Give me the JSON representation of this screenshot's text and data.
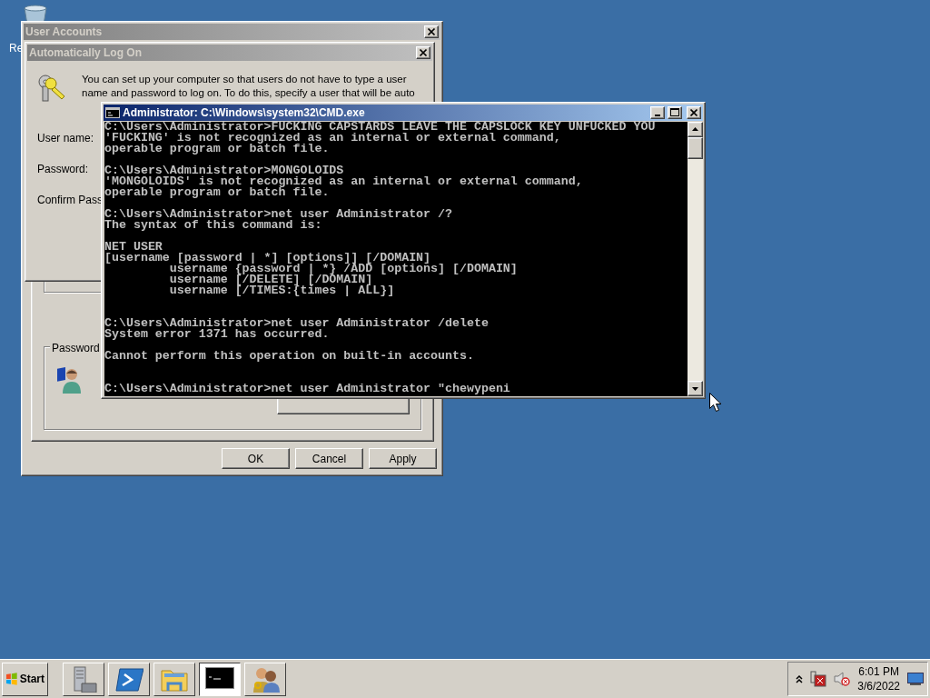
{
  "recycle_bin": {
    "label": "Re"
  },
  "user_accounts": {
    "title": "User Accounts",
    "active": false,
    "group_label": "Password",
    "buttons": [
      {
        "label": "OK"
      },
      {
        "label": "Cancel"
      },
      {
        "label": "Apply"
      }
    ]
  },
  "auto_logon": {
    "title": "Automatically Log On",
    "active": false,
    "description": "You can set up your computer so that users do not have to type a user name and password to log on. To do this, specify a user that will be auto",
    "fields": [
      {
        "label": "User name:"
      },
      {
        "label": "Password:"
      },
      {
        "label": "Confirm Pass"
      }
    ]
  },
  "console": {
    "title": "Administrator: C:\\Windows\\system32\\CMD.exe",
    "active": true,
    "lines": [
      {
        "text": "C:\\Users\\Administrator>FUCKING CAPSTARDS LEAVE THE CAPSLOCK KEY UNFUCKED YOU",
        "kind": "continued"
      },
      {
        "text": "'FUCKING' is not recognized as an internal or external command,",
        "kind": "continued"
      },
      {
        "text": "operable program or batch file.",
        "kind": "continued"
      },
      {
        "text": "C:\\Users\\Administrator>MONGOLOIDS",
        "kind": "spaced"
      },
      {
        "text": "'MONGOLOIDS' is not recognized as an internal or external command,",
        "kind": "continued"
      },
      {
        "text": "operable program or batch file.",
        "kind": "continued"
      },
      {
        "text": "C:\\Users\\Administrator>net user Administrator /?",
        "kind": "spaced"
      },
      {
        "text": "The syntax of this command is:",
        "kind": "continued"
      },
      {
        "text": "NET USER",
        "kind": "spaced"
      },
      {
        "text": "[username [password | *] [options]] [/DOMAIN]",
        "kind": "continued"
      },
      {
        "text": "         username {password | *} /ADD [options] [/DOMAIN]",
        "kind": "continued"
      },
      {
        "text": "         username [/DELETE] [/DOMAIN]",
        "kind": "continued"
      },
      {
        "text": "         username [/TIMES:{times | ALL}]",
        "kind": "continued"
      },
      {
        "text": "C:\\Users\\Administrator>net user Administrator /delete",
        "kind": "separated"
      },
      {
        "text": "System error 1371 has occurred.",
        "kind": "continued"
      },
      {
        "text": "Cannot perform this operation on built-in accounts.",
        "kind": "spaced"
      },
      {
        "text": "C:\\Users\\Administrator>net user Administrator \"chewypeni",
        "kind": "separated"
      }
    ]
  },
  "taskbar": {
    "start_label": "Start",
    "apps": [
      {
        "kind": "server",
        "selected": false
      },
      {
        "kind": "shell",
        "selected": false
      },
      {
        "kind": "folder",
        "selected": false
      },
      {
        "kind": "console",
        "selected": true
      },
      {
        "kind": "users",
        "selected": false
      }
    ],
    "clock": {
      "time": "6:01 PM",
      "date": "3/6/2022"
    }
  }
}
